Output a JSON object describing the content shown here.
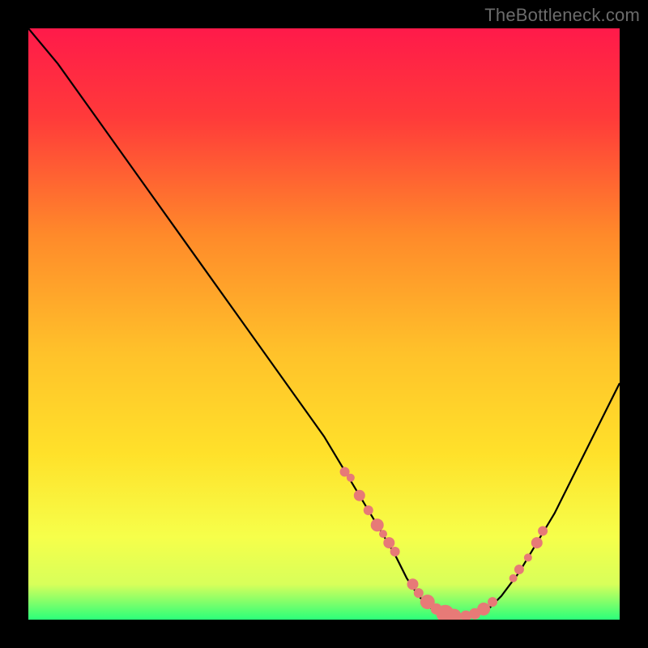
{
  "watermark": "TheBottleneck.com",
  "colors": {
    "bg": "#000000",
    "grad_top": "#ff1a4a",
    "grad_mid1": "#ff8a2a",
    "grad_mid2": "#ffe12a",
    "grad_low": "#fcff6b",
    "grad_bottom": "#2bff7a",
    "curve": "#000000",
    "marker": "#e77a77"
  },
  "chart_data": {
    "type": "line",
    "title": "",
    "xlabel": "",
    "ylabel": "",
    "xlim": [
      0,
      100
    ],
    "ylim": [
      0,
      100
    ],
    "series": [
      {
        "name": "bottleneck-curve",
        "x": [
          0,
          5,
          10,
          15,
          20,
          25,
          30,
          35,
          40,
          45,
          50,
          53,
          56,
          59,
          62,
          64,
          66,
          68,
          70,
          72,
          74,
          76,
          78,
          80,
          83,
          86,
          89,
          92,
          95,
          100
        ],
        "y": [
          100,
          94,
          87,
          80,
          73,
          66,
          59,
          52,
          45,
          38,
          31,
          26,
          21,
          16,
          11,
          7,
          4,
          2,
          1,
          0.5,
          0.5,
          1,
          2,
          4,
          8,
          13,
          18,
          24,
          30,
          40
        ]
      }
    ],
    "markers": {
      "name": "highlight-points",
      "x": [
        53.5,
        54.5,
        56,
        57.5,
        59,
        60,
        61,
        62,
        65,
        66,
        67.5,
        69,
        70.5,
        72,
        74,
        75.5,
        77,
        78.5,
        82,
        83,
        84.5,
        86,
        87
      ],
      "y": [
        25,
        24,
        21,
        18.5,
        16,
        14.5,
        13,
        11.5,
        6,
        4.5,
        3,
        1.8,
        1,
        0.6,
        0.6,
        1,
        1.8,
        3,
        7,
        8.5,
        10.5,
        13,
        15
      ],
      "sizes": [
        6,
        5,
        7,
        6,
        8,
        5,
        7,
        6,
        7,
        6,
        9,
        7,
        11,
        9,
        7,
        7,
        8,
        6,
        5,
        6,
        5,
        7,
        6
      ]
    }
  }
}
